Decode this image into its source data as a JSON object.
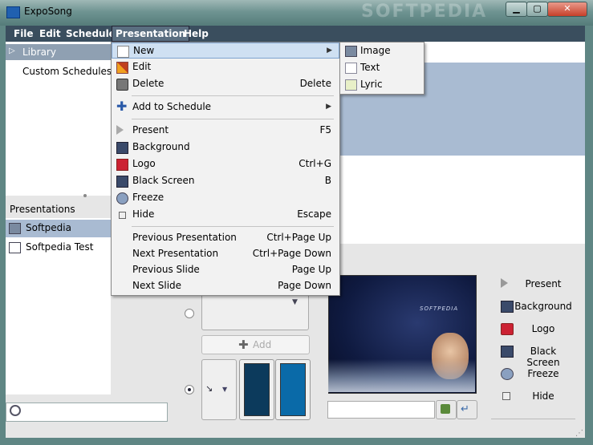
{
  "window": {
    "title": "ExpoSong",
    "watermark": "SOFTPEDIA",
    "minimize_glyph": "▁",
    "maximize_glyph": "▢",
    "close_glyph": "✕"
  },
  "menubar": [
    "File",
    "Edit",
    "Schedule",
    "Presentation",
    "Help"
  ],
  "library": {
    "header": "Library",
    "items": [
      "Custom Schedules"
    ]
  },
  "presentations": {
    "label": "Presentations",
    "items": [
      {
        "name": "Softpedia",
        "selected": true
      },
      {
        "name": "Softpedia Test",
        "selected": false
      }
    ]
  },
  "presentation_menu": {
    "items": [
      {
        "label": "New",
        "shortcut": "",
        "submenu": true,
        "icon": "new-icon"
      },
      {
        "label": "Edit",
        "shortcut": "",
        "icon": "edit-icon"
      },
      {
        "label": "Delete",
        "shortcut": "Delete",
        "icon": "delete-icon"
      },
      {
        "label": "Add to Schedule",
        "shortcut": "",
        "submenu": true,
        "icon": "add-icon"
      },
      {
        "label": "Present",
        "shortcut": "F5",
        "icon": "present-icon"
      },
      {
        "label": "Background",
        "shortcut": "",
        "icon": "background-icon"
      },
      {
        "label": "Logo",
        "shortcut": "Ctrl+G",
        "icon": "logo-icon"
      },
      {
        "label": "Black Screen",
        "shortcut": "B",
        "icon": "black-screen-icon"
      },
      {
        "label": "Freeze",
        "shortcut": "",
        "icon": "freeze-icon"
      },
      {
        "label": "Hide",
        "shortcut": "Escape",
        "icon": "hide-icon"
      },
      {
        "label": "Previous Presentation",
        "shortcut": "Ctrl+Page Up"
      },
      {
        "label": "Next Presentation",
        "shortcut": "Ctrl+Page Down"
      },
      {
        "label": "Previous Slide",
        "shortcut": "Page Up"
      },
      {
        "label": "Next Slide",
        "shortcut": "Page Down"
      }
    ],
    "submenu_arrow": "▶"
  },
  "new_submenu": [
    "Image",
    "Text",
    "Lyric"
  ],
  "editor": {
    "add_label": "Add",
    "add_glyph": "✚",
    "direction_glyph": "↘",
    "dropdown_glyph": "▼",
    "swatch_colors": [
      "#0c3a5c",
      "#0a6aa8"
    ],
    "preview_text": "SOFTPEDIA"
  },
  "actions": [
    "Present",
    "Background",
    "Logo",
    "Black Screen",
    "Freeze",
    "Hide"
  ],
  "icons": {
    "library_expand": "▷",
    "search": "search-icon",
    "grip": "⋰"
  }
}
